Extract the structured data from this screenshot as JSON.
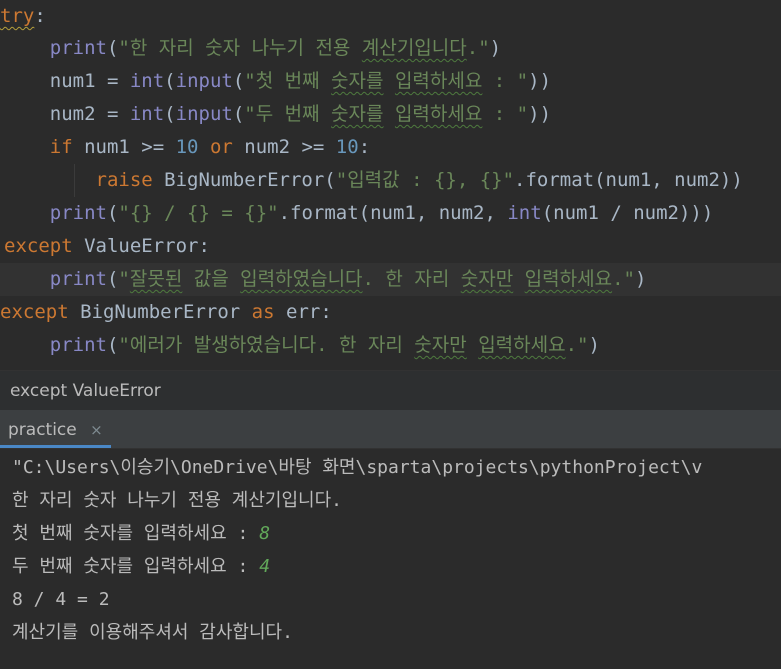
{
  "editor": {
    "lines": [
      {
        "tokens": [
          {
            "t": "try",
            "c": "kw squig-y"
          },
          {
            "t": ":",
            "c": "plain"
          }
        ]
      },
      {
        "tokens": [
          {
            "t": "    "
          },
          {
            "t": "print",
            "c": "fn"
          },
          {
            "t": "(",
            "c": "plain"
          },
          {
            "t": "\"한 자리 숫자 나누기 전용 ",
            "c": "str"
          },
          {
            "t": "계산기입니다",
            "c": "str squig"
          },
          {
            "t": ".\"",
            "c": "str"
          },
          {
            "t": ")",
            "c": "plain"
          }
        ]
      },
      {
        "tokens": [
          {
            "t": "    num1 = ",
            "c": "plain"
          },
          {
            "t": "int",
            "c": "fn"
          },
          {
            "t": "(",
            "c": "plain"
          },
          {
            "t": "input",
            "c": "fn"
          },
          {
            "t": "(",
            "c": "plain"
          },
          {
            "t": "\"첫 번째 ",
            "c": "str"
          },
          {
            "t": "숫자를",
            "c": "str squig"
          },
          {
            "t": " ",
            "c": "str"
          },
          {
            "t": "입력하세요",
            "c": "str squig"
          },
          {
            "t": " : \"",
            "c": "str"
          },
          {
            "t": "))",
            "c": "plain"
          }
        ]
      },
      {
        "tokens": [
          {
            "t": "    num2 = ",
            "c": "plain"
          },
          {
            "t": "int",
            "c": "fn"
          },
          {
            "t": "(",
            "c": "plain"
          },
          {
            "t": "input",
            "c": "fn"
          },
          {
            "t": "(",
            "c": "plain"
          },
          {
            "t": "\"두 번째 ",
            "c": "str"
          },
          {
            "t": "숫자를",
            "c": "str squig"
          },
          {
            "t": " ",
            "c": "str"
          },
          {
            "t": "입력하세요",
            "c": "str squig"
          },
          {
            "t": " : \"",
            "c": "str"
          },
          {
            "t": "))",
            "c": "plain"
          }
        ]
      },
      {
        "tokens": [
          {
            "t": "    "
          },
          {
            "t": "if",
            "c": "kw"
          },
          {
            "t": " num1 >= ",
            "c": "plain"
          },
          {
            "t": "10",
            "c": "num"
          },
          {
            "t": " ",
            "c": "plain"
          },
          {
            "t": "or",
            "c": "kw"
          },
          {
            "t": " num2 >= ",
            "c": "plain"
          },
          {
            "t": "10",
            "c": "num"
          },
          {
            "t": ":",
            "c": "plain"
          }
        ]
      },
      {
        "tokens": [
          {
            "t": "        "
          },
          {
            "t": "raise",
            "c": "kw"
          },
          {
            "t": " BigNumberError(",
            "c": "plain"
          },
          {
            "t": "\"입력값 : {}, {}\"",
            "c": "str"
          },
          {
            "t": ".format(num1, num2))",
            "c": "plain"
          }
        ]
      },
      {
        "tokens": [
          {
            "t": "    "
          },
          {
            "t": "print",
            "c": "fn"
          },
          {
            "t": "(",
            "c": "plain"
          },
          {
            "t": "\"{} / {} = {}\"",
            "c": "str"
          },
          {
            "t": ".format(num1, num2, ",
            "c": "plain"
          },
          {
            "t": "int",
            "c": "fn"
          },
          {
            "t": "(num1 / num2)))",
            "c": "plain"
          }
        ]
      },
      {
        "tokens": [
          {
            "t": "except",
            "c": "kw"
          },
          {
            "t": " ValueError:",
            "c": "plain"
          }
        ]
      },
      {
        "tokens": [
          {
            "t": "    "
          },
          {
            "t": "print",
            "c": "fn"
          },
          {
            "t": "(",
            "c": "plain"
          },
          {
            "t": "\"",
            "c": "str"
          },
          {
            "t": "잘못된",
            "c": "str squig"
          },
          {
            "t": " 값을 ",
            "c": "str"
          },
          {
            "t": "입력하였습니다",
            "c": "str squig"
          },
          {
            "t": ". 한 자리 ",
            "c": "str"
          },
          {
            "t": "숫자만",
            "c": "str squig"
          },
          {
            "t": " ",
            "c": "str"
          },
          {
            "t": "입력하세요",
            "c": "str squig"
          },
          {
            "t": ".\"",
            "c": "str"
          },
          {
            "t": ")",
            "c": "plain"
          }
        ]
      },
      {
        "tokens": [
          {
            "t": "except",
            "c": "kw"
          },
          {
            "t": " BigNumberError ",
            "c": "plain"
          },
          {
            "t": "as",
            "c": "kw"
          },
          {
            "t": " err:",
            "c": "plain"
          }
        ]
      },
      {
        "tokens": [
          {
            "t": "    "
          },
          {
            "t": "print",
            "c": "fn"
          },
          {
            "t": "(",
            "c": "plain"
          },
          {
            "t": "\"에러가 발생하였습니다. 한 자리 ",
            "c": "str"
          },
          {
            "t": "숫자만",
            "c": "str squig"
          },
          {
            "t": " ",
            "c": "str"
          },
          {
            "t": "입력하세요",
            "c": "str squig"
          },
          {
            "t": ".\"",
            "c": "str"
          },
          {
            "t": ")",
            "c": "plain"
          }
        ]
      }
    ]
  },
  "breadcrumb": {
    "text": "except ValueError"
  },
  "run_panel": {
    "tab_label": "practice",
    "close_glyph": "×"
  },
  "console": {
    "lines": [
      {
        "text": "\"C:\\Users\\이승기\\OneDrive\\바탕 화면\\sparta\\projects\\pythonProject\\v",
        "input": ""
      },
      {
        "text": "한 자리 숫자 나누기 전용 계산기입니다.",
        "input": ""
      },
      {
        "text": "첫 번째 숫자를 입력하세요 : ",
        "input": "8"
      },
      {
        "text": "두 번째 숫자를 입력하세요 : ",
        "input": "4"
      },
      {
        "text": "8 / 4 = 2",
        "input": ""
      },
      {
        "text": "계산기를 이용해주셔서 감사합니다.",
        "input": ""
      }
    ]
  }
}
